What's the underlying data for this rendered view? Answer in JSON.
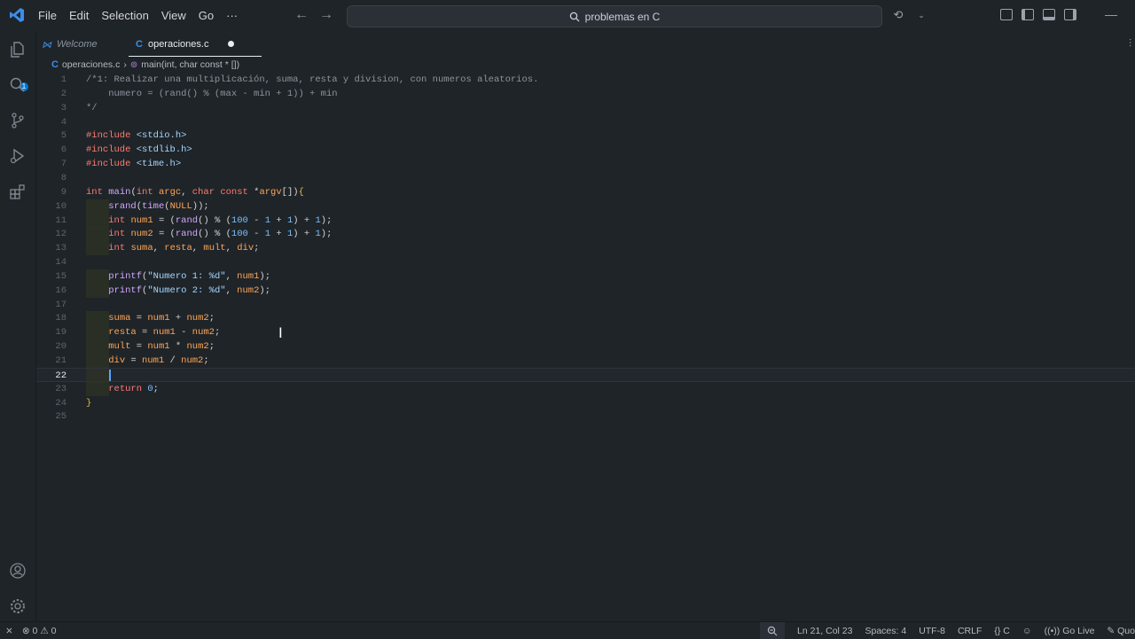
{
  "menu": [
    "File",
    "Edit",
    "Selection",
    "View",
    "Go",
    "···"
  ],
  "search": {
    "text": "problemas en C"
  },
  "tabs": [
    {
      "label": "Welcome"
    },
    {
      "label": "operaciones.c"
    }
  ],
  "breadcrumb": {
    "file": "operaciones.c",
    "symbol": "main(int, char const * [])"
  },
  "activity": {
    "explorer_badge": "1"
  },
  "editor": {
    "current_line": 22,
    "lines": [
      "/*1: Realizar una multiplicación, suma, resta y division, con numeros aleatorios.",
      "    numero = (rand() % (max - min + 1)) + min",
      "*/",
      "",
      "#include <stdio.h>",
      "#include <stdlib.h>",
      "#include <time.h>",
      "",
      "int main(int argc, char const *argv[]){",
      "    srand(time(NULL));",
      "    int num1 = (rand() % (100 - 1 + 1) + 1);",
      "    int num2 = (rand() % (100 - 1 + 1) + 1);",
      "    int suma, resta, mult, div;",
      "",
      "    printf(\"Numero 1: %d\", num1);",
      "    printf(\"Numero 2: %d\", num2);",
      "",
      "    suma = num1 + num2;",
      "    resta = num1 - num2;",
      "    mult = num1 * num2;",
      "    div = num1 / num2;",
      "",
      "    return 0;",
      "}",
      ""
    ]
  },
  "statusbar": {
    "errors": "0",
    "warnings": "0",
    "position": "Ln 21, Col 23",
    "spaces": "Spaces: 4",
    "encoding": "UTF-8",
    "eol": "CRLF",
    "language": "C",
    "golive": "Go Live",
    "quokka": "Quo"
  }
}
